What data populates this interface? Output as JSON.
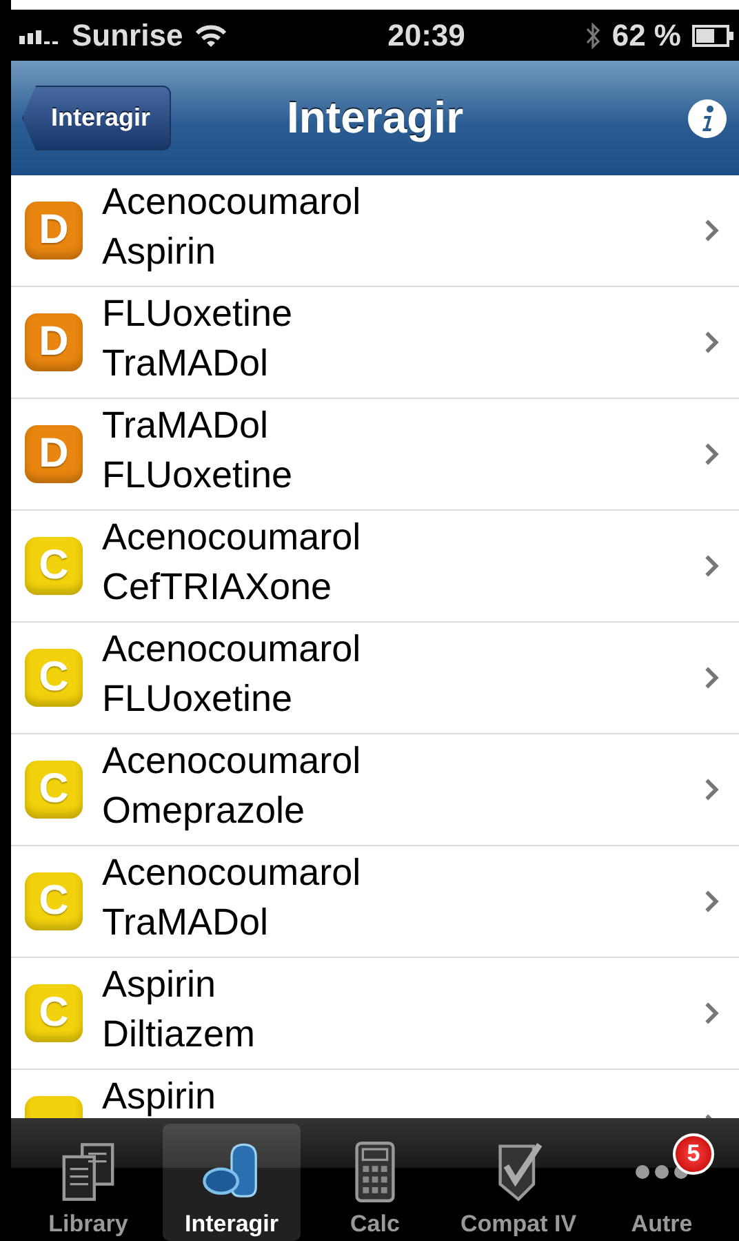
{
  "status_bar": {
    "carrier": "Sunrise",
    "time": "20:39",
    "battery": "62 %"
  },
  "nav_bar": {
    "back": "Interagir",
    "title": "Interagir"
  },
  "interactions": [
    {
      "badge": "D",
      "color": "#e8860f",
      "drugs": [
        "Acenocoumarol",
        "Aspirin"
      ]
    },
    {
      "badge": "D",
      "color": "#e8860f",
      "drugs": [
        "FLUoxetine",
        "TraMADol"
      ]
    },
    {
      "badge": "D",
      "color": "#e8860f",
      "drugs": [
        "TraMADol",
        "FLUoxetine"
      ]
    },
    {
      "badge": "C",
      "color": "#f2d20c",
      "drugs": [
        "Acenocoumarol",
        "CefTRIAXone"
      ]
    },
    {
      "badge": "C",
      "color": "#f2d20c",
      "drugs": [
        "Acenocoumarol",
        "FLUoxetine"
      ]
    },
    {
      "badge": "C",
      "color": "#f2d20c",
      "drugs": [
        "Acenocoumarol",
        "Omeprazole"
      ]
    },
    {
      "badge": "C",
      "color": "#f2d20c",
      "drugs": [
        "Acenocoumarol",
        "TraMADol"
      ]
    },
    {
      "badge": "C",
      "color": "#f2d20c",
      "drugs": [
        "Aspirin",
        "Diltiazem"
      ]
    },
    {
      "color": "#f2d20c",
      "drugs": [
        "Aspirin"
      ]
    }
  ],
  "tab_bar": [
    {
      "kind": "library",
      "label": "Library",
      "selected": false
    },
    {
      "kind": "interact",
      "label": "Interagir",
      "selected": true
    },
    {
      "kind": "calc",
      "label": "Calc",
      "selected": false
    },
    {
      "kind": "compat",
      "label": "Compat IV",
      "selected": false
    },
    {
      "kind": "more",
      "label": "Autre",
      "selected": false,
      "badge": "5"
    }
  ]
}
